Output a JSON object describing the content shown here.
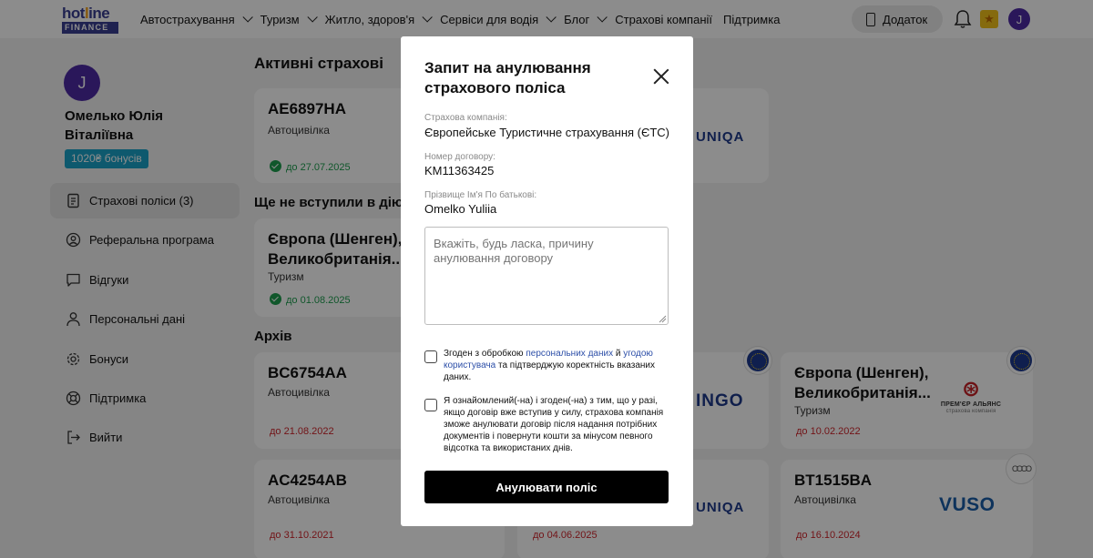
{
  "header": {
    "logo_top": "hotline",
    "logo_bottom": "FINANCE",
    "nav": [
      {
        "label": "Автострахування",
        "dropdown": true
      },
      {
        "label": "Туризм",
        "dropdown": true
      },
      {
        "label": "Житло, здоров'я",
        "dropdown": true
      },
      {
        "label": "Сервіси для водія",
        "dropdown": true
      },
      {
        "label": "Блог",
        "dropdown": true
      },
      {
        "label": "Страхові компанії",
        "dropdown": false
      },
      {
        "label": "Підтримка",
        "dropdown": false
      }
    ],
    "app_button": "Додаток",
    "avatar_letter": "J"
  },
  "sidebar": {
    "avatar_letter": "J",
    "name": "Омелько Юлія Віталіївна",
    "bonus": "1020₴ бонусів",
    "items": [
      {
        "label": "Страхові поліси (3)",
        "icon": "document-icon"
      },
      {
        "label": "Реферальна програма",
        "icon": "referral-icon"
      },
      {
        "label": "Відгуки",
        "icon": "chat-icon"
      },
      {
        "label": "Персональні дані",
        "icon": "person-icon"
      },
      {
        "label": "Бонуси",
        "icon": "gear-icon"
      },
      {
        "label": "Підтримка",
        "icon": "lifebuoy-icon"
      },
      {
        "label": "Вийти",
        "icon": "logout-icon"
      }
    ]
  },
  "main": {
    "active_title": "Активні страхові",
    "pending_title": "Ще не вступили в дію",
    "archive_title": "Архів",
    "cards": {
      "c1": {
        "number": "AE6897HA",
        "type": "Автоцивілка",
        "date": "до 27.07.2025",
        "brand": "UNIQA"
      },
      "c2": {
        "number": "Європа (Шенген), Великобританія...",
        "type": "Туризм",
        "date": "до 01.08.2025"
      },
      "c3": {
        "number": "BC6754AA",
        "type": "Автоцивілка",
        "date": "до 21.08.2022",
        "brand": "INGO"
      },
      "c4": {
        "number": "Європа (Шенген), Великобританія...",
        "type": "Туризм",
        "date": "до 10.02.2022",
        "brand": "ПРЕМ'ЄР АЛЬЯНС",
        "brand_sub": "страхова компанія"
      },
      "c5": {
        "number": "AC4254AB",
        "type": "Автоцивілка",
        "date": "до 31.10.2021"
      },
      "c6": {
        "date": "до 04.06.2025",
        "brand": "UNIQA"
      },
      "c7": {
        "number": "BT1515BA",
        "type": "Автоцивілка",
        "date": "до 16.10.2024",
        "brand": "VUSO"
      }
    }
  },
  "modal": {
    "title": "Запит на анулювання страхового поліса",
    "company_label": "Страхова компанія:",
    "company_value": "Європейське Туристичне страхування (ЄТС)",
    "contract_label": "Номер договору:",
    "contract_value": "KM11363425",
    "name_label": "Прізвище Ім'я По батькові:",
    "name_value": "Omelko Yuliia",
    "reason_placeholder": "Вкажіть, будь ласка, причину анулювання договору",
    "consent1_a": "Згоден з обробкою ",
    "consent1_link1": "персональних даних",
    "consent1_b": " й ",
    "consent1_link2": "угодою користувача",
    "consent1_c": " та підтверджую коректність вказаних даних.",
    "consent2": "Я ознайомлений(-на) і згоден(-на) з тим, що у разі, якщо договір вже вступив у силу, страхова компанія зможе анулювати договір після надання потрібних документів і повернути кошти за мінусом певного відсотка та використаних днів.",
    "submit": "Анулювати поліс"
  },
  "colors": {
    "accent": "#4e2aa5",
    "bonus": "#1aa3c8",
    "valid": "#1e9e4f",
    "expired": "#d0262c",
    "link": "#2d4fa8"
  }
}
